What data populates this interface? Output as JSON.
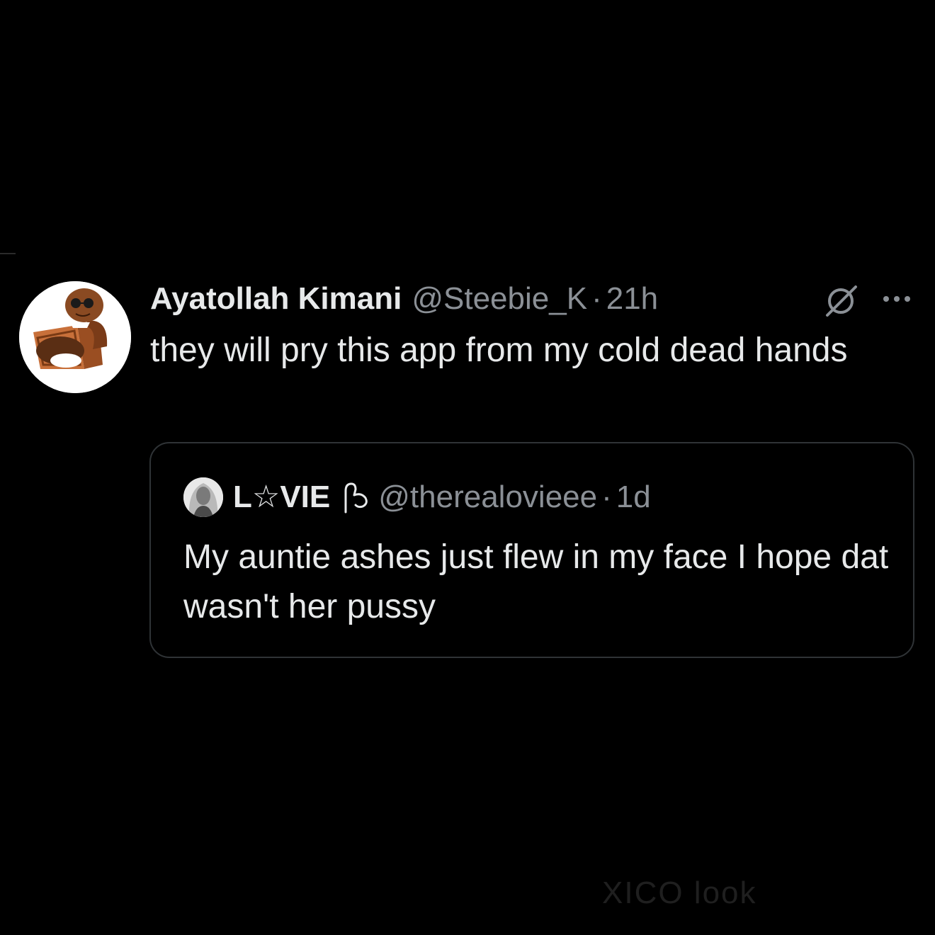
{
  "tweet": {
    "author": {
      "display_name": "Ayatollah Kimani",
      "handle": "@Steebie_K"
    },
    "separator": "·",
    "timestamp": "21h",
    "text": "they will pry this app from my cold dead hands",
    "icons": {
      "grok": "grok-icon",
      "more": "more-options-icon"
    }
  },
  "quote": {
    "author": {
      "display_name": "L☆VIE",
      "handle": "@therealovieee"
    },
    "separator": "·",
    "timestamp": "1d",
    "text": "My auntie ashes just flew in my face I hope dat wasn't her pussy",
    "icons": {
      "emoji": "flexed-arm-emoji"
    }
  },
  "background_text": "XICO look"
}
